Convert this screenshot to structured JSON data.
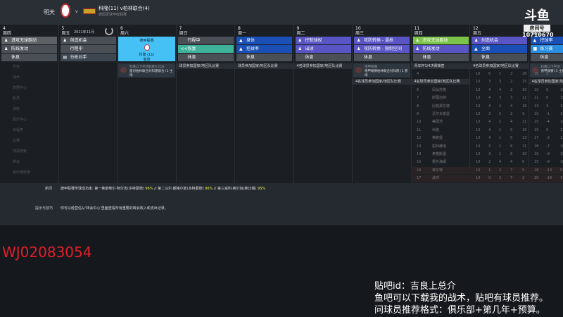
{
  "header": {
    "when": "明天",
    "vs": "v",
    "match": "科隆(11) v柏林联合(4)",
    "competition": "德国足球甲级联赛",
    "month": "2021年11月"
  },
  "days": [
    {
      "num": "4",
      "dow": "周四",
      "acts": [
        {
          "label": "进攻无球跑动",
          "icon": "run"
        },
        {
          "label": "防线发动",
          "icon": "run"
        },
        {
          "label": "休息",
          "icon": ""
        }
      ],
      "color": [
        "#5d6166",
        "#4a4f56",
        "#4a4f56"
      ]
    },
    {
      "num": "5",
      "dow": "周五",
      "acts": [
        {
          "label": "创造机会",
          "icon": "run"
        },
        {
          "label": "行程中",
          "icon": ""
        },
        {
          "label": "分析对手",
          "icon": "doc"
        }
      ],
      "color": [
        "#4a4f56",
        "#4a4f56",
        "#3e4650"
      ]
    },
    {
      "num": "6",
      "dow": "周六",
      "match": {
        "comp": "德甲联赛",
        "team": "科隆 (11)",
        "venue": "客场"
      },
      "note": {
        "title": "科隆以下半场取胜扎比法",
        "text": "面对柏林联合对科隆联合 (1 主场"
      }
    },
    {
      "num": "7",
      "dow": "周日",
      "acts": [
        {
          "label": "行程中",
          "icon": ""
        },
        {
          "label": "恢复",
          "icon": "<<"
        },
        {
          "label": "休息",
          "icon": ""
        }
      ],
      "color": [
        "#4a4f56",
        "#3fb39a",
        "#4a4f56"
      ],
      "note": "球员参加国家/地区队比赛"
    },
    {
      "num": "8",
      "dow": "周一",
      "acts": [
        {
          "label": "身体",
          "icon": "▲"
        },
        {
          "label": "控球率",
          "icon": "▲"
        },
        {
          "label": "休息",
          "icon": ""
        }
      ],
      "color": [
        "#1a4fb5",
        "#1a4fb5",
        "#4a4f56"
      ],
      "note": "球员参加国家/地区队比赛"
    },
    {
      "num": "9",
      "dow": "周二",
      "acts": [
        {
          "label": "控制球权",
          "icon": "run"
        },
        {
          "label": "出球",
          "icon": "run"
        },
        {
          "label": "休息",
          "icon": ""
        }
      ],
      "color": [
        "#5a55c4",
        "#5a55c4",
        "#4a4f56"
      ],
      "note": "4名球员参加国家/地区队比赛"
    },
    {
      "num": "10",
      "dow": "周三",
      "acts": [
        {
          "label": "攻防转换 - 逼抢",
          "icon": "run"
        },
        {
          "label": "攻防转换 - 限制空间",
          "icon": "run"
        },
        {
          "label": "休息",
          "icon": ""
        }
      ],
      "color": [
        "#5a55c4",
        "#5a55c4",
        "#4a4f56"
      ],
      "note": {
        "title": "德甲联赛",
        "text": "德甲联赛柏林联合对科隆 (1 客场"
      },
      "note2": "4名球员参加国家/地区队比赛"
    },
    {
      "num": "11",
      "dow": "周四",
      "acts": [
        {
          "label": "进攻无球跑动",
          "icon": "run"
        },
        {
          "label": "防线发动",
          "icon": "run"
        },
        {
          "label": "休息",
          "icon": ""
        }
      ],
      "color": [
        "#7cc34a",
        "#5a55c4",
        "#4a4f56"
      ],
      "note": "青年杯1/4决赛抽签",
      "note2": "4名球员参加国家/地区队比赛"
    },
    {
      "num": "12",
      "dow": "周五",
      "acts": [
        {
          "label": "创造机会",
          "icon": "run"
        },
        {
          "label": "全面",
          "icon": "▲"
        },
        {
          "label": "休息",
          "icon": ""
        }
      ],
      "color": [
        "#5a55c4",
        "#1a4fb5",
        "#4a4f56"
      ],
      "note": "4名球员参加国家/地区队比赛"
    },
    {
      "num": "13",
      "dow": "周六",
      "acts": [
        {
          "label": "控球率",
          "icon": "▲"
        },
        {
          "label": "练习赛",
          "icon": "■"
        },
        {
          "label": "休息",
          "icon": ""
        }
      ],
      "color": [
        "#1a4fb5",
        "#2a8de0",
        "#4a4f56"
      ],
      "note": {
        "title": "科隆以下半场",
        "text": "德甲联赛 (1 主场"
      },
      "note2": "4名球员参加国家/地区队比赛"
    }
  ],
  "sidebar": [
    "阵容",
    "战术",
    "数据中心",
    "职员",
    "训练",
    "医疗中心",
    "日程表",
    "比赛",
    "球探搜索",
    "转会",
    "俱乐部愿景"
  ],
  "table": [
    [
      "4",
      "",
      "10",
      "6",
      "1",
      "3",
      "26",
      "18",
      "8",
      "19"
    ],
    [
      "5",
      "门兴",
      "10",
      "3",
      "3",
      "2",
      "15",
      "6",
      "9",
      "18"
    ],
    [
      "6",
      "凤仙苏格",
      "10",
      "4",
      "4",
      "2",
      "10",
      "10",
      "0",
      "16"
    ],
    [
      "7",
      "斯图加特",
      "10",
      "4",
      "3",
      "3",
      "11",
      "11",
      "0",
      "15"
    ],
    [
      "8",
      "比勒费尔德",
      "10",
      "4",
      "2",
      "4",
      "16",
      "13",
      "3",
      "14"
    ],
    [
      "9",
      "沃尔夫斯堡",
      "10",
      "3",
      "5",
      "2",
      "9",
      "10",
      "-1",
      "14"
    ],
    [
      "10",
      "美因茨",
      "10",
      "4",
      "2",
      "4",
      "11",
      "15",
      "-4",
      "14"
    ],
    [
      "11",
      "科隆",
      "10",
      "4",
      "1",
      "5",
      "15",
      "15",
      "0",
      "13"
    ],
    [
      "12",
      "弗赖堡",
      "10",
      "4",
      "1",
      "5",
      "13",
      "17",
      "-3",
      "13"
    ],
    [
      "13",
      "柏林赫塔",
      "10",
      "3",
      "1",
      "6",
      "11",
      "18",
      "-7",
      "10"
    ],
    [
      "14",
      "奥格斯堡",
      "10",
      "3",
      "1",
      "6",
      "10",
      "19",
      "-9",
      "10"
    ],
    [
      "15",
      "霍芬海姆",
      "10",
      "2",
      "4",
      "4",
      "6",
      "15",
      "-9",
      "10"
    ],
    [
      "16",
      "菲尔特",
      "10",
      "1",
      "2",
      "7",
      "5",
      "18",
      "-13",
      "5"
    ],
    [
      "17",
      "波鸿",
      "10",
      "0",
      "3",
      "7",
      "2",
      "20",
      "-18",
      "3"
    ]
  ],
  "bottom": {
    "news_label": "新闻",
    "news": "德甲联赛传球成功率: 第一莱斯维尔·阿尔吉(多特蒙德)",
    "p1": "96%",
    "sep1": " // 第二马尔·朗格尔斯(多特蒙德)",
    "p2": "96%",
    "sep2": " // 第三威利·奥尔班(莱比锡)",
    "p3": "95%",
    "tips_label": "提示与技巧",
    "tips": "你可以经营信从'转会中心'里面查看所有重要的转会收入和支出记录。"
  },
  "overlay": {
    "logo": "斗鱼",
    "room_label": "房间号",
    "room": "10710670",
    "watermark": "WJ02083054",
    "lines": [
      "贴吧id：吉良上总介",
      "鱼吧可以下载我的战术，贴吧有球员推荐。",
      "问球员推荐格式：俱乐部+第几年+预算。"
    ]
  }
}
